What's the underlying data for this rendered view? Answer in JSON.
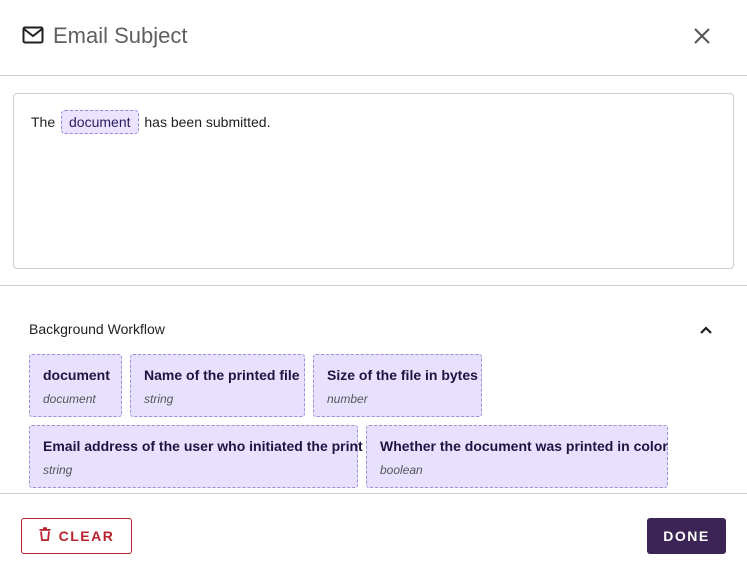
{
  "dialog": {
    "title": "Email Subject",
    "icon": "mail-icon",
    "close_icon": "close-icon"
  },
  "editor": {
    "text_before": "The",
    "token": "document",
    "text_after": "has been submitted."
  },
  "variables": {
    "section_title": "Background Workflow",
    "collapse_icon": "chevron-up-icon",
    "items": [
      {
        "label": "document",
        "type": "document"
      },
      {
        "label": "Name of the printed file",
        "type": "string"
      },
      {
        "label": "Size of the file in bytes",
        "type": "number"
      },
      {
        "label": "Email address of the user who initiated the print",
        "type": "string"
      },
      {
        "label": "Whether the document was printed in color",
        "type": "boolean"
      }
    ]
  },
  "footer": {
    "clear_label": "CLEAR",
    "clear_icon": "trash-icon",
    "done_label": "DONE"
  },
  "colors": {
    "accent": "#3c2456",
    "danger": "#b8232f",
    "chip_bg": "#e7e0ff"
  }
}
